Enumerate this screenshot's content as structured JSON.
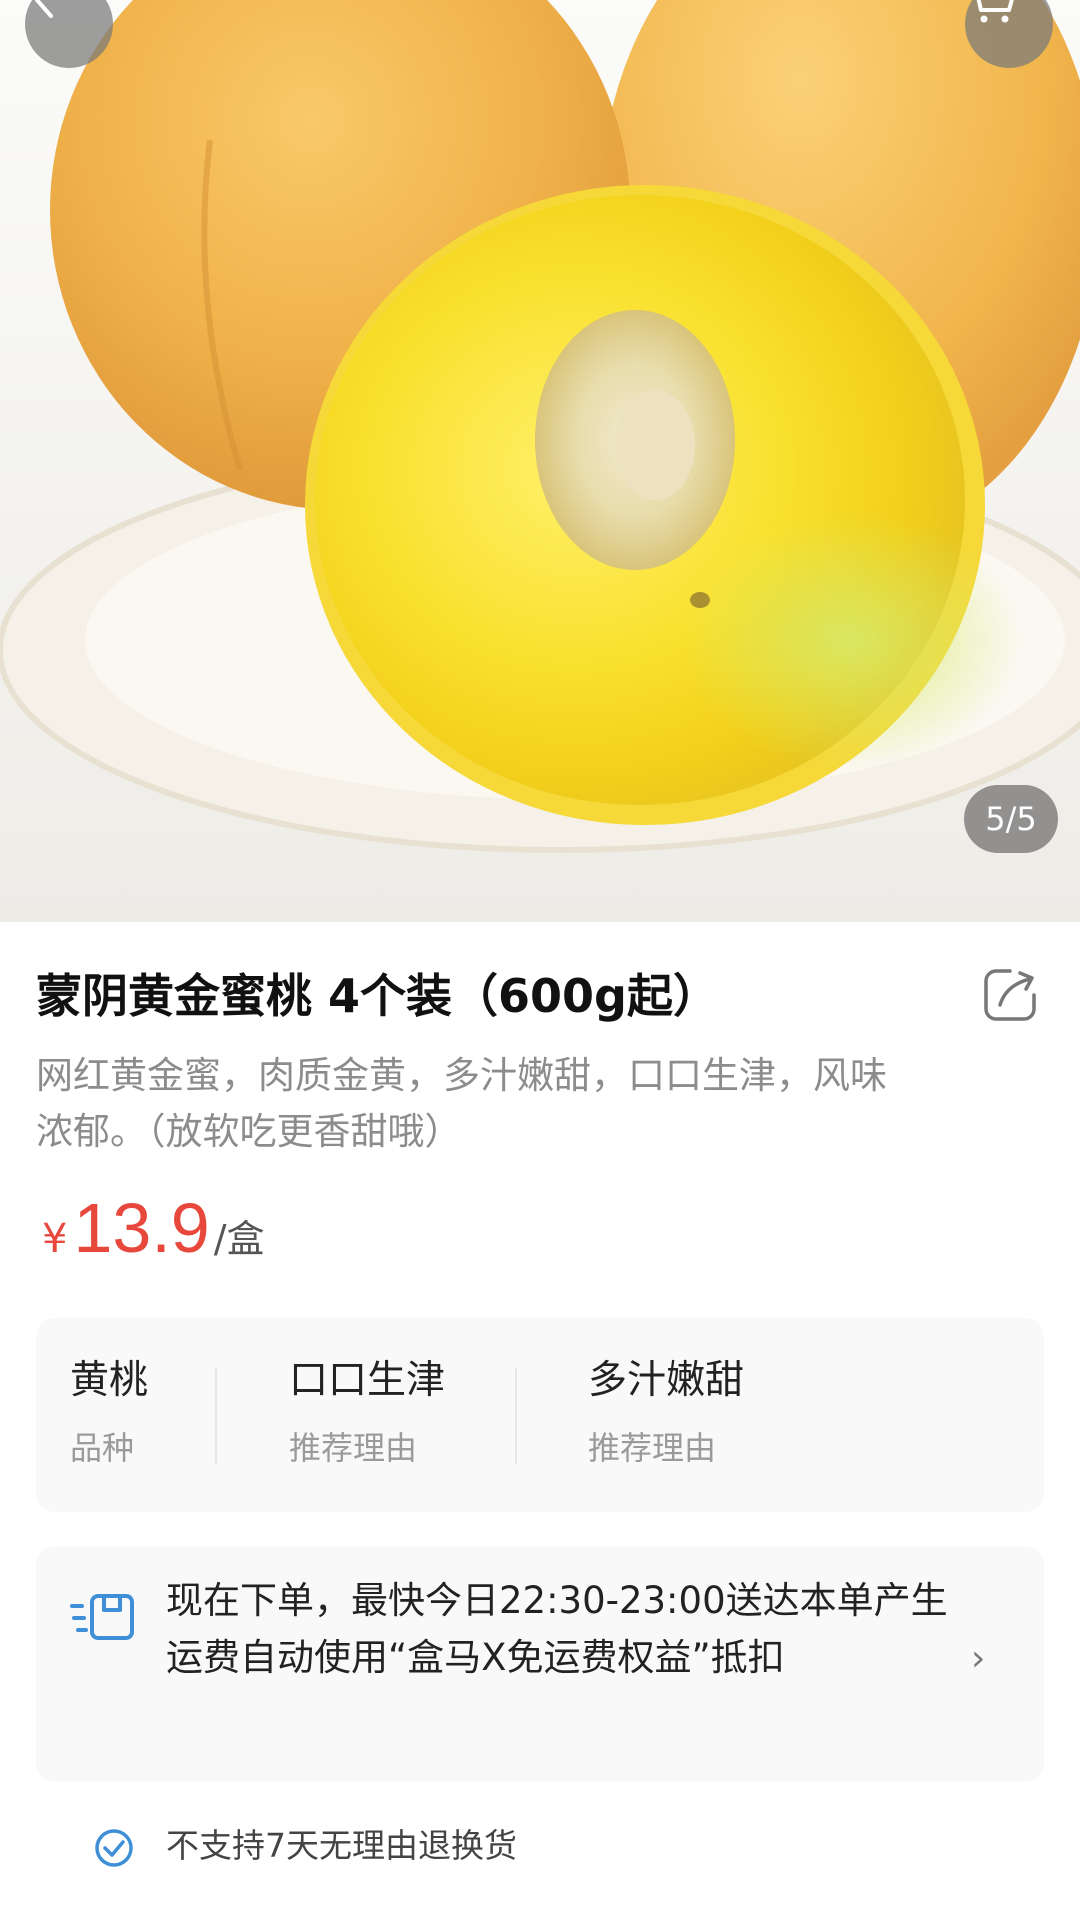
{
  "header": {
    "back_icon": "chevron-left-icon",
    "cart_icon": "shopping-cart-icon"
  },
  "gallery": {
    "indicator": "5/5"
  },
  "product": {
    "title": "蒙阴黄金蜜桃 4个装（600g起）",
    "subtitle": "网红黄金蜜，肉质金黄，多汁嫩甜，口口生津，风味浓郁。（放软吃更香甜哦）",
    "share_icon": "share-icon",
    "price": {
      "symbol": "¥",
      "value": "13.9",
      "unit": "/盒",
      "color": "#e8473b"
    }
  },
  "attributes": [
    {
      "value": "黄桃",
      "label": "品种"
    },
    {
      "value": "口口生津",
      "label": "推荐理由"
    },
    {
      "value": "多汁嫩甜",
      "label": "推荐理由"
    }
  ],
  "delivery": {
    "icon": "delivery-box-icon",
    "text": "现在下单，最快今日22:30-23:00送达本单产生运费自动使用“盒马X免运费权益”抵扣",
    "arrow": "›",
    "icon_color": "#3f8fd8"
  },
  "policy": {
    "icon": "check-circle-icon",
    "text": "不支持7天无理由退换货"
  }
}
